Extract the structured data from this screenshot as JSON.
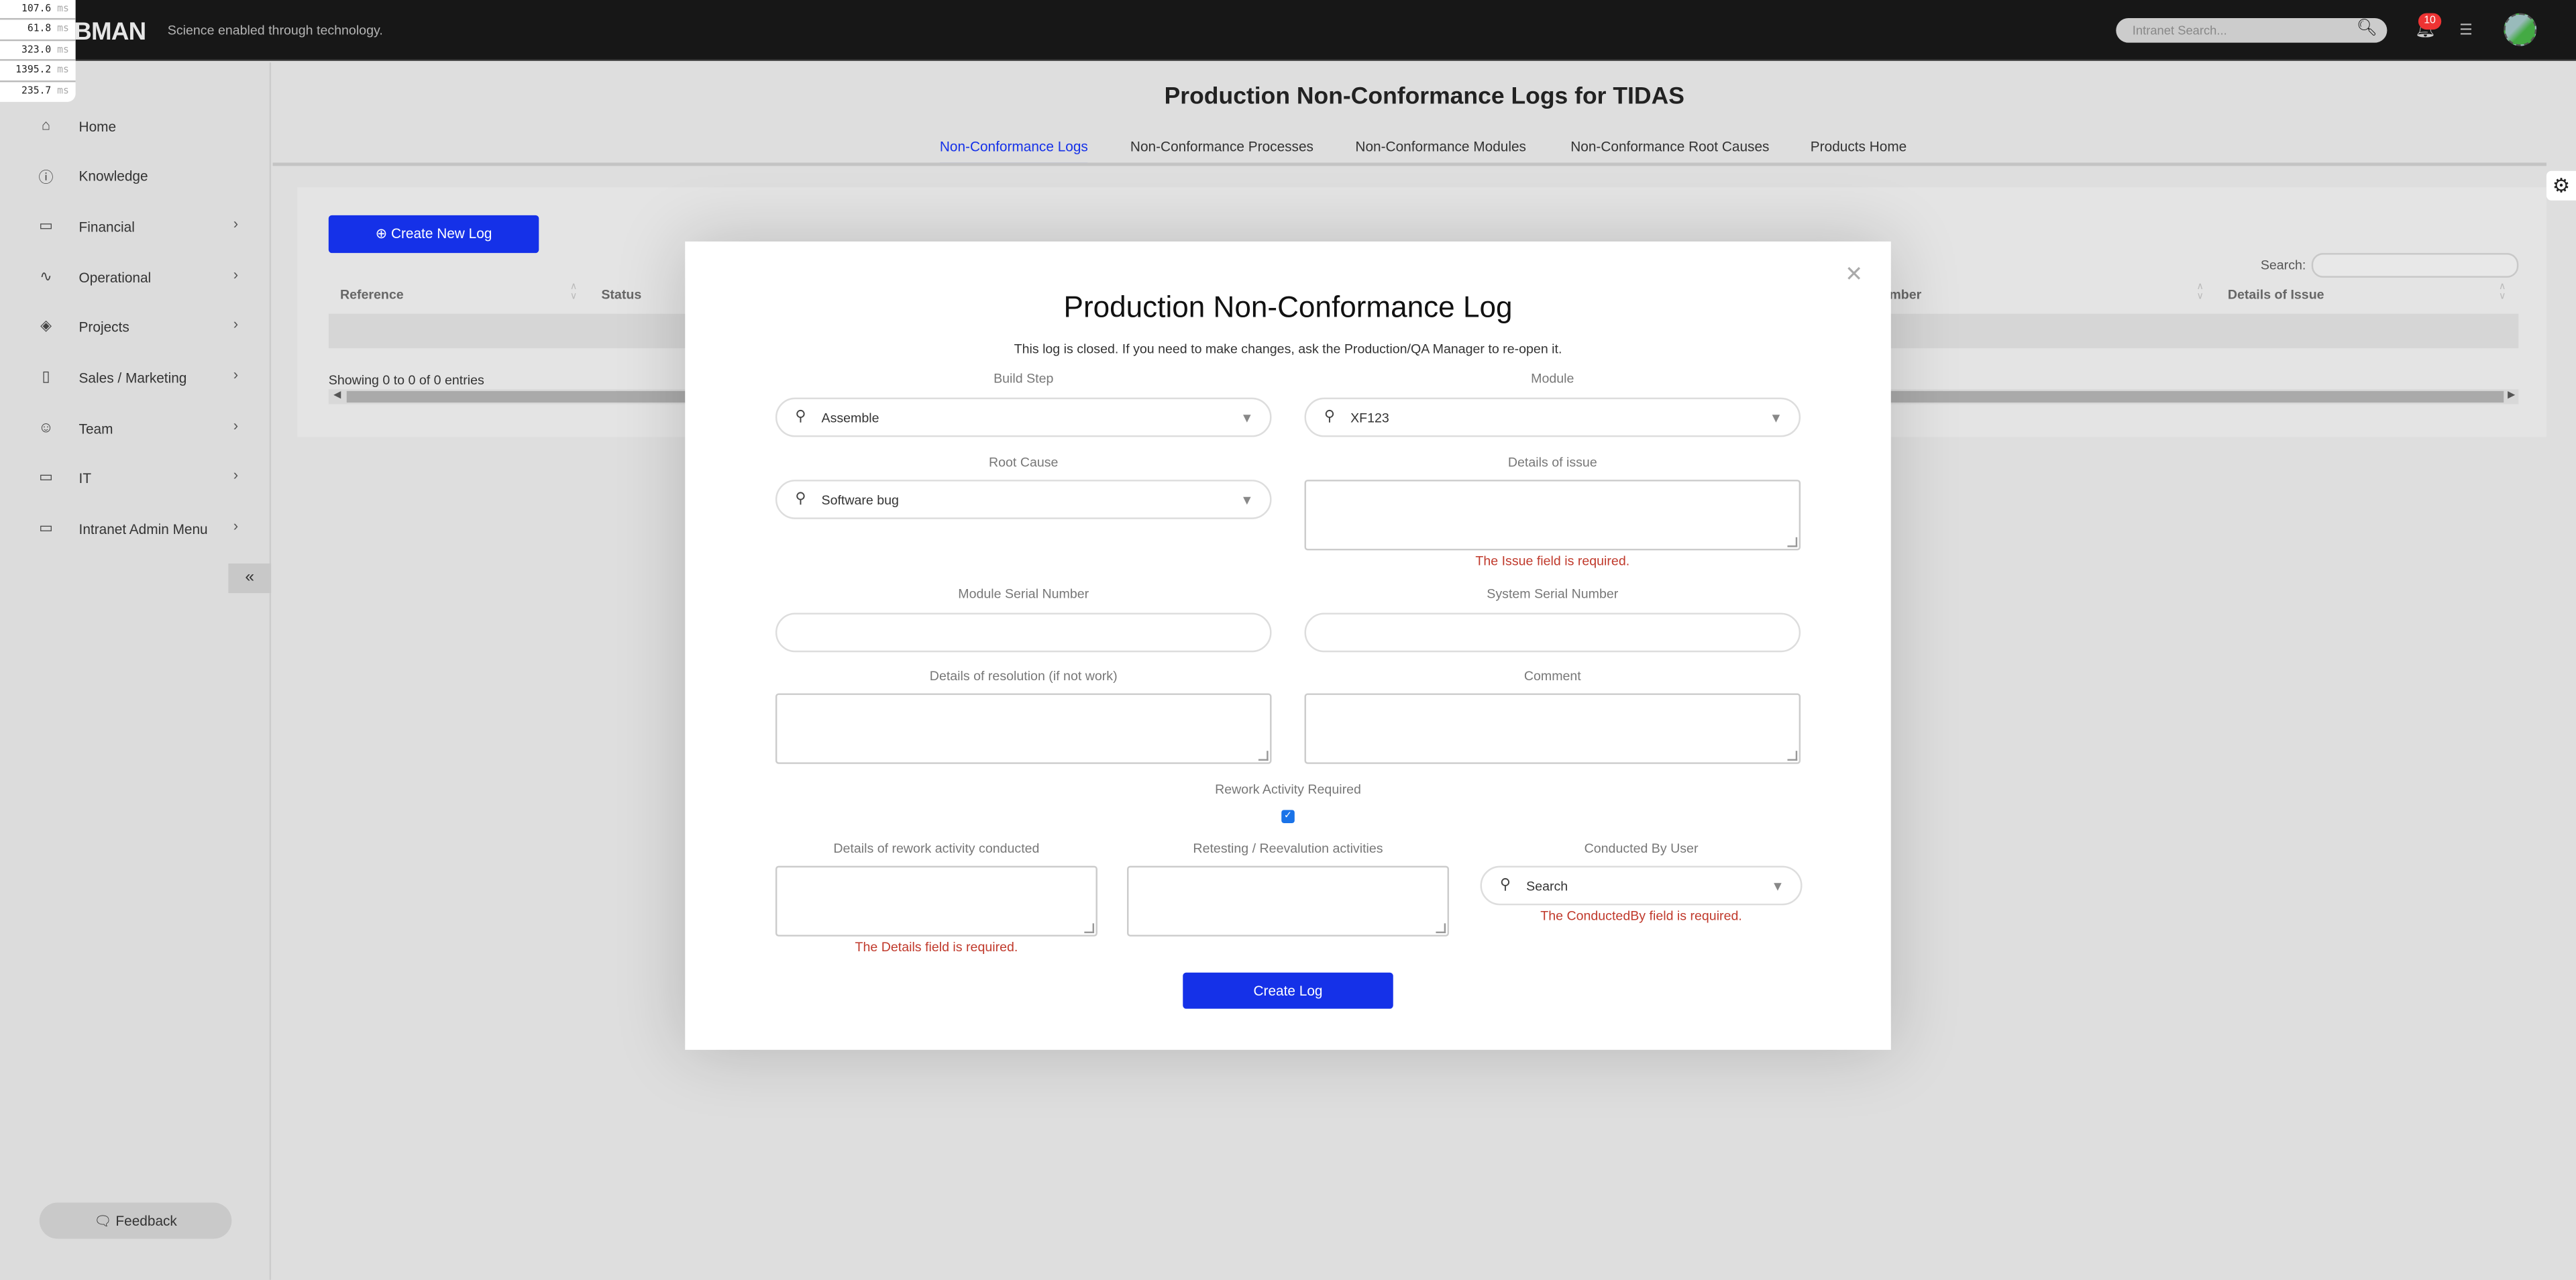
{
  "perf_overlay": {
    "values": [
      "107.6",
      "61.8",
      "323.0",
      "1395.2",
      "235.7"
    ],
    "unit": "ms"
  },
  "header": {
    "logo": "BMAN",
    "tagline": "Science enabled through technology.",
    "search_placeholder": "Intranet Search...",
    "notification_count": "10"
  },
  "sidebar": {
    "items": [
      {
        "label": "Home",
        "icon": "home-icon",
        "chevron": false
      },
      {
        "label": "Knowledge",
        "icon": "info-icon",
        "chevron": false
      },
      {
        "label": "Financial",
        "icon": "card-icon",
        "chevron": true
      },
      {
        "label": "Operational",
        "icon": "activity-icon",
        "chevron": true
      },
      {
        "label": "Projects",
        "icon": "layers-icon",
        "chevron": true
      },
      {
        "label": "Sales / Marketing",
        "icon": "book-icon",
        "chevron": true
      },
      {
        "label": "Team",
        "icon": "users-icon",
        "chevron": true
      },
      {
        "label": "IT",
        "icon": "card-icon",
        "chevron": true
      },
      {
        "label": "Intranet Admin Menu",
        "icon": "card-icon",
        "chevron": true
      }
    ],
    "feedback": "Feedback"
  },
  "page": {
    "title": "Production Non-Conformance Logs for TIDAS",
    "tabs": [
      {
        "label": "Non-Conformance Logs",
        "active": true
      },
      {
        "label": "Non-Conformance Processes"
      },
      {
        "label": "Non-Conformance Modules"
      },
      {
        "label": "Non-Conformance Root Causes"
      },
      {
        "label": "Products Home"
      }
    ],
    "create_new": "Create New Log",
    "search_label": "Search:",
    "columns": [
      "Reference",
      "Status",
      "mber",
      "Details of Issue"
    ],
    "showing": "Showing 0 to 0 of 0 entries"
  },
  "modal": {
    "title": "Production Non-Conformance Log",
    "note": "This log is closed. If you need to make changes, ask the Production/QA Manager to re-open it.",
    "build_step": {
      "label": "Build Step",
      "value": "Assemble"
    },
    "module": {
      "label": "Module",
      "value": "XF123"
    },
    "root_cause": {
      "label": "Root Cause",
      "value": "Software bug"
    },
    "details_issue": {
      "label": "Details of issue",
      "error": "The Issue field is required."
    },
    "module_serial": {
      "label": "Module Serial Number"
    },
    "system_serial": {
      "label": "System Serial Number"
    },
    "resolution": {
      "label": "Details of resolution (if not work)"
    },
    "comment": {
      "label": "Comment"
    },
    "rework": {
      "label": "Rework Activity Required",
      "checked": true
    },
    "rework_details": {
      "label": "Details of rework activity conducted",
      "error": "The Details field is required."
    },
    "retesting": {
      "label": "Retesting / Reevalution activities"
    },
    "conducted_by": {
      "label": "Conducted By User",
      "placeholder": "Search",
      "error": "The ConductedBy field is required."
    },
    "submit": "Create Log"
  },
  "colors": {
    "accent": "#1531e8",
    "error": "#c0392b",
    "topbar": "#171717"
  }
}
